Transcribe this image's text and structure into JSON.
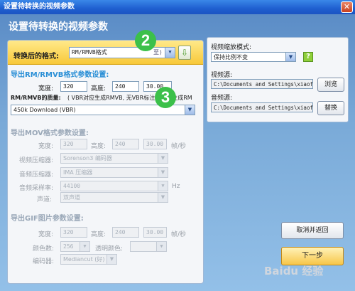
{
  "window": {
    "title": "设置待转换的视频参数",
    "close_glyph": "✕"
  },
  "header": {
    "title": "设置待转换的视频参数"
  },
  "format": {
    "label": "转换后的格式:",
    "value": "RM/RMVB格式",
    "value_suffix": "至)",
    "dropdown_icon": "chevron-down-icon"
  },
  "rm_section": {
    "title": "导出RM/RMVB格式参数设置:",
    "width_label": "宽度:",
    "width_value": "320",
    "height_label": "高度:",
    "height_value": "240",
    "fps_value": "30.00",
    "quality_label": "RM/RMVB的质量:",
    "quality_note": "( VBR对应生成RMVB, 无VBR标注选项则生成RM )",
    "quality_value": "450k Download (VBR)"
  },
  "mov_section": {
    "title": "导出MOV格式参数设置:",
    "width_label": "宽度:",
    "width_value": "320",
    "height_label": "高度:",
    "height_value": "240",
    "fps_value": "30.00",
    "fps_unit": "帧/秒",
    "video_codec_label": "视频压缩器:",
    "video_codec_value": "Sorenson3 编码器",
    "audio_codec_label": "音频压缩器:",
    "audio_codec_value": "IMA 压缩器",
    "sample_rate_label": "音频采样率:",
    "sample_rate_value": "44100",
    "sample_rate_unit": "Hz",
    "channel_label": "声道:",
    "channel_value": "双声道"
  },
  "gif_section": {
    "title": "导出GIF图片参数设置:",
    "width_label": "宽度:",
    "width_value": "320",
    "height_label": "高度:",
    "height_value": "240",
    "fps_value": "30.00",
    "fps_unit": "帧/秒",
    "colors_label": "颜色数:",
    "colors_value": "256",
    "transparent_label": "透明颜色:",
    "encoder_label": "编码器:",
    "encoder_value": "Mediancut (好)"
  },
  "right_panel": {
    "scale_mode_label": "视频缩放模式:",
    "scale_mode_value": "保持比例不变",
    "video_source_label": "视频源:",
    "video_source_value": "C:\\Documents and Settings\\xiaofer",
    "browse_button": "浏览",
    "audio_source_label": "音频源:",
    "audio_source_value": "C:\\Documents and Settings\\xiaofer",
    "replace_button": "替换"
  },
  "buttons": {
    "cancel_return": "取消并返回",
    "next_step": "下一步"
  },
  "annotations": {
    "badge_2": "2",
    "badge_3": "3"
  },
  "watermark": "Baidu 经验",
  "colors": {
    "accent_blue": "#2a8fd6",
    "title_bar": "#1f5fd0",
    "format_bar": "#f8c93a",
    "badge": "#3cc04a"
  }
}
